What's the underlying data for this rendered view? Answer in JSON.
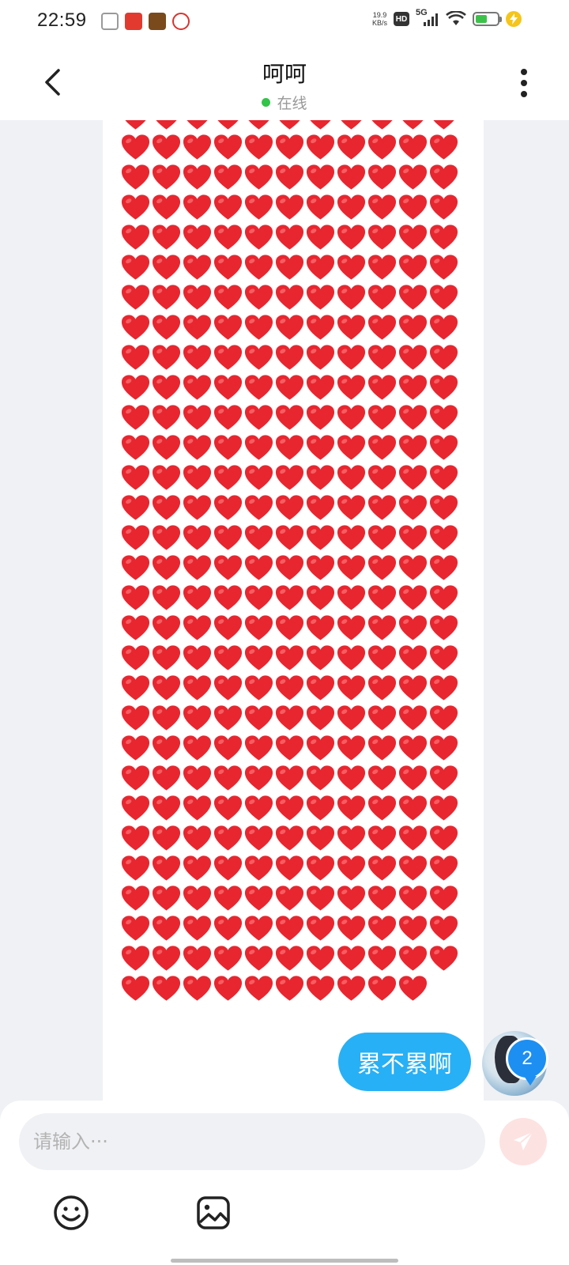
{
  "status_bar": {
    "time": "22:59",
    "net_speed_value": "19.9",
    "net_speed_unit": "KB/s",
    "hd_label": "HD",
    "network_label": "5G",
    "battery_level": 0.55,
    "app_icon_colors": [
      "#9a9a9a",
      "#e23a2f",
      "#7a4a1c",
      "#d8342e"
    ]
  },
  "header": {
    "title": "呵呵",
    "status": "在线"
  },
  "messages": {
    "heart_text": "❤❤❤❤❤❤❤❤❤❤❤❤❤❤❤❤❤❤❤❤❤❤❤❤❤❤❤❤❤❤❤❤❤❤❤❤❤❤❤❤❤❤❤❤❤❤❤❤❤❤❤❤❤❤❤❤❤❤❤❤❤❤❤❤❤❤❤❤❤❤❤❤❤❤❤❤❤❤❤❤❤❤❤❤❤❤❤❤❤❤❤❤❤❤❤❤❤❤❤❤❤❤❤❤❤❤❤❤❤❤❤❤❤❤❤❤❤❤❤❤❤❤❤❤❤❤❤❤❤❤❤❤❤❤❤❤❤❤❤❤❤❤❤❤❤❤❤❤❤❤❤❤❤❤❤❤❤❤❤❤❤❤❤❤❤❤❤❤❤❤❤❤❤❤❤❤❤❤❤❤❤❤❤❤❤❤❤❤❤❤❤❤❤❤❤❤❤❤❤❤❤❤❤❤❤❤❤❤❤❤❤❤❤❤❤❤❤❤❤❤❤❤❤❤❤❤❤❤❤❤❤❤❤❤❤❤❤❤❤❤❤❤❤❤❤❤❤❤❤❤❤❤❤❤❤❤❤❤❤❤❤❤❤❤❤❤❤❤❤❤❤❤❤❤❤❤❤❤❤❤❤❤❤❤❤❤❤❤❤❤❤❤❤❤❤❤❤❤❤❤❤❤❤❤❤❤❤❤❤❤❤❤❤❤❤❤❤❤❤❤❤❤❤❤❤❤❤❤❤",
    "my_message": "累不累啊",
    "avatar_badge": "2"
  },
  "input": {
    "placeholder": "请输入···",
    "value": ""
  },
  "colors": {
    "accent_blue": "#27b0f5",
    "badge_blue": "#1d8ff2",
    "online_green": "#31c448",
    "heart_red": "#e8262f",
    "send_disabled": "#fde2e2"
  },
  "icons": {
    "back": "chevron-left-icon",
    "more": "more-vertical-icon",
    "send": "send-plane-icon",
    "emoji": "smiley-icon",
    "image": "image-icon"
  }
}
